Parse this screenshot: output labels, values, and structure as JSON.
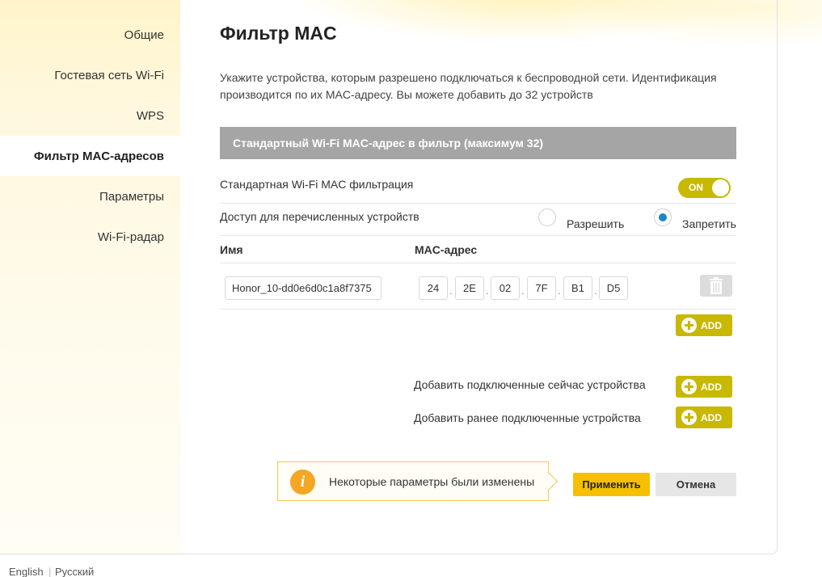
{
  "sidebar": {
    "items": [
      {
        "label": "Общие"
      },
      {
        "label": "Гостевая сеть Wi-Fi"
      },
      {
        "label": "WPS"
      },
      {
        "label": "Фильтр MAC-адресов"
      },
      {
        "label": "Параметры"
      },
      {
        "label": "Wi-Fi-радар"
      }
    ],
    "active_index": 3
  },
  "main": {
    "title": "Фильтр MAC",
    "description": "Укажите устройства, которым разрешено подключаться к беспроводной сети. Идентификация производится по их MAC-адресу. Вы можете добавить до 32 устройств",
    "section_header": "Стандартный Wi-Fi MAC-адрес в фильтр (максимум 32)",
    "filter_toggle": {
      "label": "Стандартная Wi-Fi MAC фильтрация",
      "state": "ON"
    },
    "access": {
      "label": "Доступ для перечисленных устройств",
      "allow_label": "Разрешить",
      "deny_label": "Запретить",
      "selected": "deny"
    },
    "table": {
      "col_name": "Имя",
      "col_mac": "MAC-адрес",
      "rows": [
        {
          "name": "Honor_10-dd0e6d0c1a8f7375",
          "mac": [
            "24",
            "2E",
            "02",
            "7F",
            "B1",
            "D5"
          ]
        }
      ]
    },
    "add_label": "ADD",
    "add_connected_label": "Добавить подключенные сейчас устройства",
    "add_previous_label": "Добавить ранее подключенные устройства",
    "notice": {
      "icon": "info-icon",
      "text": "Некоторые параметры были изменены"
    },
    "apply_label": "Применить",
    "cancel_label": "Отмена"
  },
  "footer": {
    "languages": [
      "English",
      "Русский"
    ]
  },
  "colors": {
    "accent": "#c8b800",
    "apply": "#f6c000",
    "header_gray": "#a5a5a5",
    "radio_selected": "#1a86c8",
    "info": "#f5a623"
  }
}
